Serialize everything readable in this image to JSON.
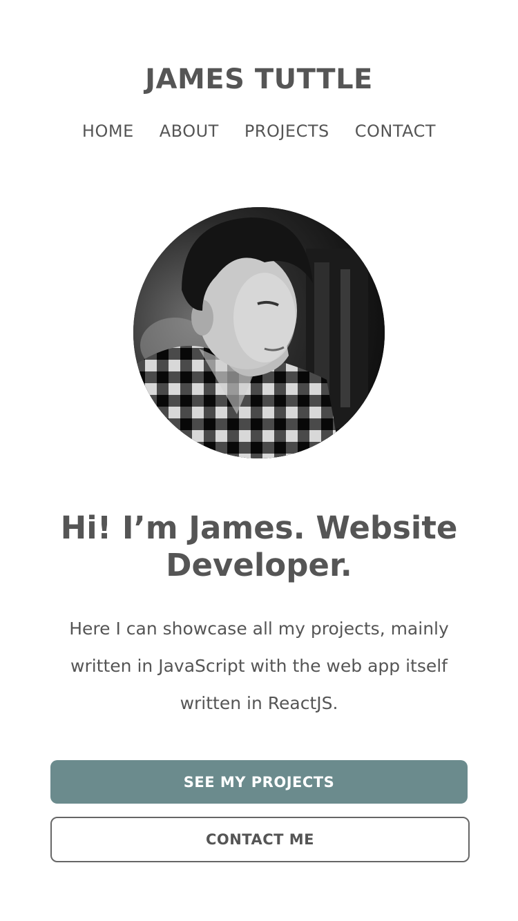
{
  "header": {
    "site_title": "JAMES TUTTLE",
    "nav": [
      "HOME",
      "ABOUT",
      "PROJECTS",
      "CONTACT"
    ]
  },
  "hero": {
    "headline_line1": "Hi! I’m James. Website",
    "headline_line2": "Developer.",
    "intro": "Here I can showcase all my projects, mainly written in JavaScript with the web app itself written in ReactJS.",
    "primary_button": "SEE MY PROJECTS",
    "secondary_button": "CONTACT ME"
  },
  "colors": {
    "text": "#555555",
    "primary_button_bg": "#6b8b8d",
    "background": "#ffffff"
  }
}
